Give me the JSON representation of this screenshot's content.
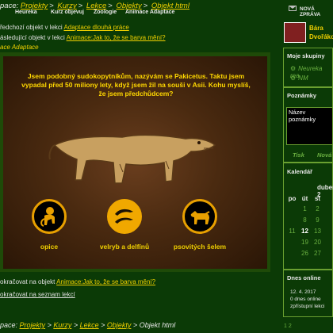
{
  "header": {
    "crumb_prefix": "pace:",
    "crumbs": [
      "Projekty",
      "Kurzy",
      "Lekce",
      "Objekty",
      "Objekt html"
    ],
    "crumb_subs": [
      "Heureka",
      "Kurz objevuj",
      "Zoologie",
      "Animace Adaptace"
    ],
    "message_label": "NOVÁ ZPRÁVA"
  },
  "nav": {
    "prev_text": "ředchozí objekt v lekci",
    "prev_link": "Adaptace dlouhá práce",
    "next_text": "ásledující objekt v lekci",
    "next_link": "Animace:Jak to, že se barva mění?",
    "title": "ace Adaptace"
  },
  "game": {
    "question": "Jsem podobný sudokopytníkům, nazývám se Pakicetus. Taktu jsem vypadal před 50 miliony lety, když jsem žil na souši v Asii. Kohu myslíš, že jsem předchůdcem?",
    "choices": [
      {
        "label": "opice",
        "icon": "monkey-icon",
        "selected": false
      },
      {
        "label": "velryb a delfínů",
        "icon": "dolphin-icon",
        "selected": true
      },
      {
        "label": "psovitých šelem",
        "icon": "dog-icon",
        "selected": false
      }
    ]
  },
  "footer_nav": {
    "continue_text": "okračovat na objekt",
    "continue_link": "Animace:Jak to, že se barva mění?",
    "list_link": "okračovat na seznam lekcí"
  },
  "bottom_breadcrumb": {
    "prefix": "pace:",
    "crumbs": [
      "Projekty",
      "Kurzy",
      "Lekce",
      "Objekty"
    ],
    "last": "Objekt html"
  },
  "sidebar": {
    "user_name": [
      "Bára",
      "Dvořákov"
    ],
    "groups_title": "Moje skupiny",
    "groups": [
      "Neureka rea",
      "NM"
    ],
    "notes_title": "Poznámky",
    "note_title": "Název poznámky",
    "print_label": "Tisk",
    "new_label": "Nová",
    "calendar_title": "Kalendář",
    "month": "duben 2",
    "weekdays": [
      "po",
      "út",
      "st"
    ],
    "weeks": [
      [
        "",
        "1",
        "2"
      ],
      [
        "",
        "8",
        "9"
      ],
      [
        "11",
        "12",
        "13"
      ],
      [
        "",
        "19",
        "20"
      ],
      [
        "",
        "26",
        "27"
      ]
    ],
    "online_title": "Dnes online",
    "online_lines": [
      "12. 4. 2017",
      "0 dnes online",
      "zpřístupní lekci"
    ],
    "pager": "1 2"
  },
  "colors": {
    "background": "#0b3a06",
    "link": "#f0d000",
    "accent": "#6ab040",
    "stage": "#4a2a10"
  }
}
